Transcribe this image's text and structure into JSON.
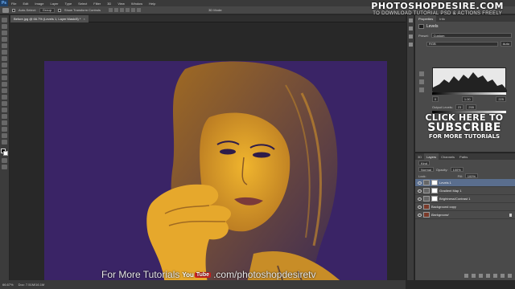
{
  "app": {
    "logo": "Ps"
  },
  "menu": [
    "File",
    "Edit",
    "Image",
    "Layer",
    "Type",
    "Select",
    "Filter",
    "3D",
    "View",
    "Window",
    "Help"
  ],
  "options_bar": {
    "auto_select_label": "Auto-Select:",
    "auto_select_value": "Group",
    "transform_label": "Show Transform Controls",
    "mode_label": "3D Mode:"
  },
  "watermark": {
    "title": "PHOTOSHOPDESIRE.COM",
    "subtitle": "TO DOWNLOAD TUTORIAL PSD & ACTIONS FREELY"
  },
  "document": {
    "tab_title": "Before.jpg @ 66.7% (Levels 1, Layer Mask/8) *",
    "close": "×"
  },
  "status": {
    "zoom": "66.67%",
    "doc_size": "Doc: 7.51M/16.1M"
  },
  "footer": {
    "prefix": "For More Tutorials",
    "you": "You",
    "tube": "Tube",
    "suffix": ".com/photoshopdesiretv"
  },
  "properties": {
    "tabs": [
      "Properties",
      "Info"
    ],
    "title": "Levels",
    "preset_label": "Preset:",
    "preset_value": "Custom",
    "channel_value": "RGB",
    "auto_label": "Auto",
    "input_levels": [
      "0",
      "1.00",
      "225"
    ],
    "output_label": "Output Levels:",
    "output_levels": [
      "23",
      "255"
    ]
  },
  "subscribe": {
    "line1": "CLICK HERE TO",
    "line2": "SUBSCRIBE",
    "line3": "FOR MORE TUTORIALS"
  },
  "layers_panel": {
    "tabs": [
      "3D",
      "Layers",
      "Channels",
      "Paths"
    ],
    "kind_label": "Kind",
    "blend_mode": "Normal",
    "opacity_label": "Opacity:",
    "opacity_value": "100%",
    "lock_label": "Lock:",
    "fill_label": "Fill:",
    "fill_value": "100%",
    "layers": [
      {
        "name": "Levels 1"
      },
      {
        "name": "Gradient Map 1"
      },
      {
        "name": "Brightness/Contrast 1"
      },
      {
        "name": "Background copy"
      },
      {
        "name": "Background"
      }
    ]
  },
  "colors": {
    "duotone_dark": "#3a2466",
    "duotone_light": "#e0a22a",
    "selected_layer": "#5a6e8e"
  }
}
